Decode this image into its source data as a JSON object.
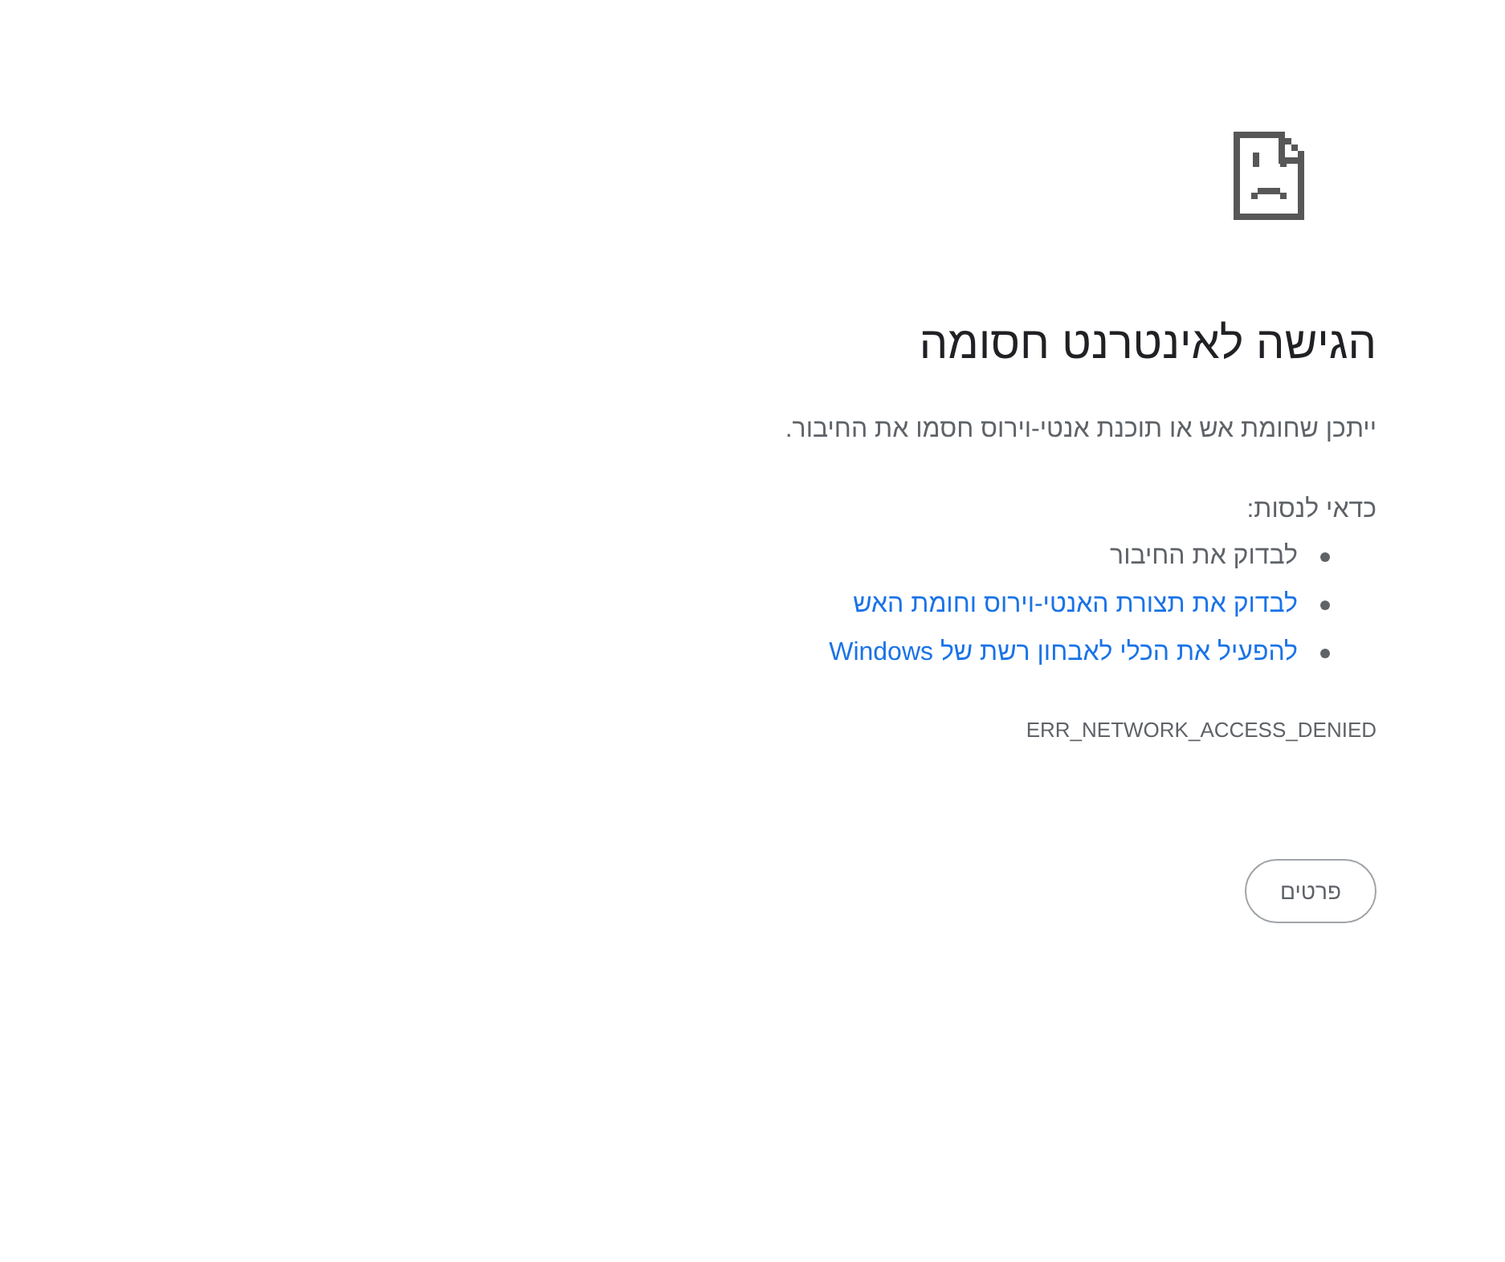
{
  "error_page": {
    "title": "הגישה לאינטרנט חסומה",
    "message": "ייתכן שחומת אש או תוכנת אנטי-וירוס חסמו את החיבור.",
    "suggestions_heading": "כדאי לנסות:",
    "suggestions": [
      {
        "kind": "plain",
        "text": "לבדוק את החיבור"
      },
      {
        "kind": "link",
        "text": "לבדוק את תצורת האנטי-וירוס וחומת האש"
      },
      {
        "kind": "link",
        "text": "להפעיל את הכלי לאבחון רשת של Windows"
      }
    ],
    "error_code": "ERR_NETWORK_ACCESS_DENIED",
    "buttons": [
      "פרטים"
    ]
  }
}
